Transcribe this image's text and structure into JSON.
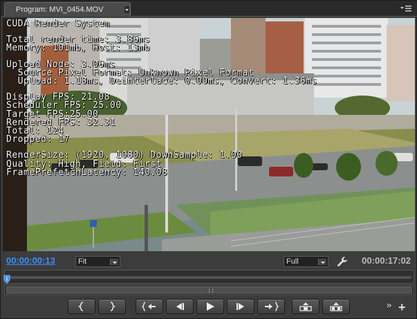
{
  "tab": {
    "title": "Program: MVI_0454.MOV"
  },
  "overlay": {
    "lines": [
      "CUDA Render System",
      "",
      "Total render time: 3.86ms",
      "Memory: 101mb, Host: 13mb",
      "",
      "Upload Node: 3.06ms",
      "  Source Pixel Format: Unknown Pixel Format",
      "  Upload: 1.18ms, Deinterlace: 0.00ms, Convert: 1.36ms",
      "",
      "Display FPS: 21.08",
      "Scheduler FPS: 25.00",
      "Target FPS:25.00",
      "Rendered FPS: 32.31",
      "Total: 124",
      "Dropped: 17",
      "",
      "RenderSize: (1920, 1080) DownSample: 1.00",
      "Quality: High, Field: First",
      "FramePrefetchLatency: 140.08"
    ]
  },
  "controls": {
    "current_timecode": "00:00:00:13",
    "zoom_value": "Fit",
    "resolution_value": "Full",
    "duration_timecode": "00:00:17:02"
  },
  "colors": {
    "timecode_accent": "#3a8fff",
    "panel_bg": "#3c3c3c"
  },
  "transport": [
    {
      "name": "mark-in-button",
      "icon": "mark-in-icon"
    },
    {
      "name": "mark-out-button",
      "icon": "mark-out-icon"
    },
    {
      "name": "go-to-in-button",
      "icon": "go-to-in-icon"
    },
    {
      "name": "step-back-button",
      "icon": "step-back-icon"
    },
    {
      "name": "play-button",
      "icon": "play-icon"
    },
    {
      "name": "step-forward-button",
      "icon": "step-forward-icon"
    },
    {
      "name": "go-to-out-button",
      "icon": "go-to-out-icon"
    },
    {
      "name": "lift-button",
      "icon": "lift-icon"
    },
    {
      "name": "extract-button",
      "icon": "extract-icon"
    }
  ]
}
